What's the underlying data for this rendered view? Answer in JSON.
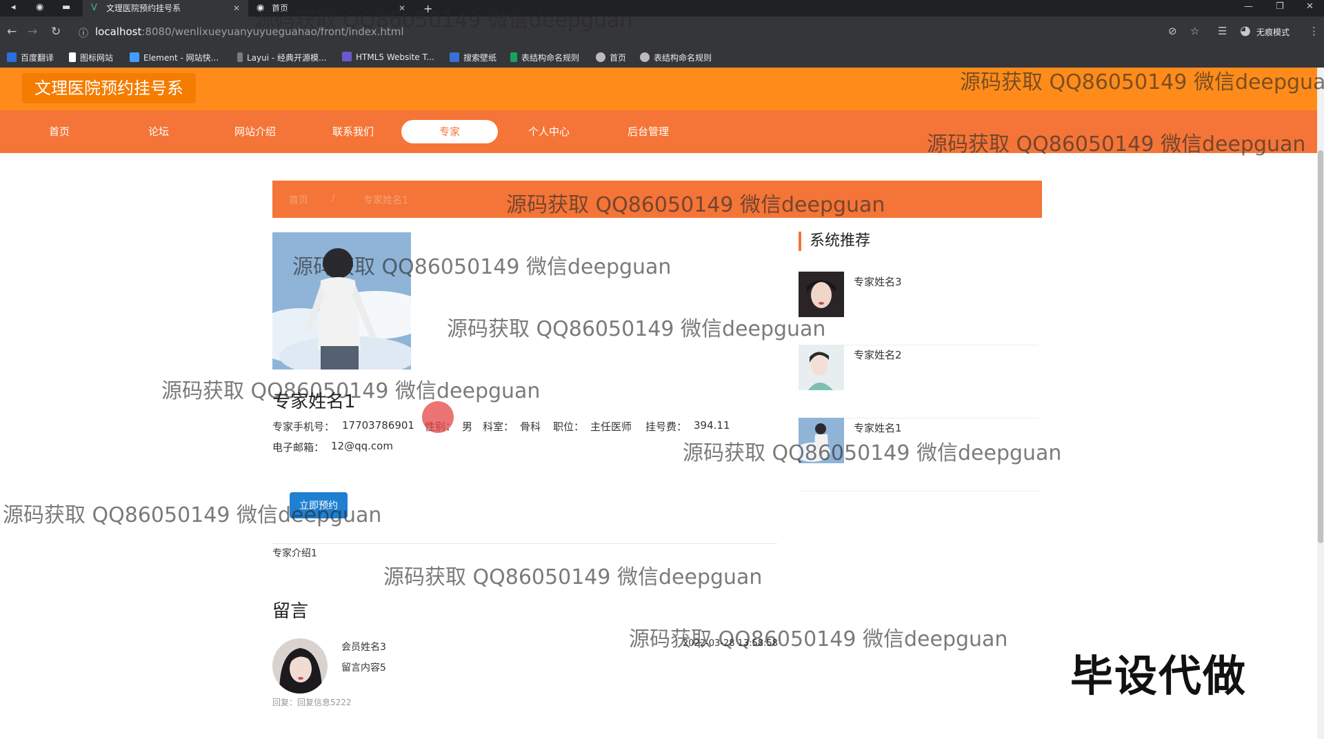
{
  "browser": {
    "tabs": [
      {
        "label": "文理医院预约挂号系",
        "active": true
      },
      {
        "label": "首页",
        "active": false
      }
    ],
    "url_host": "localhost",
    "url_path": ":8080/wenlixueyuanyuyueguahao/front/index.html",
    "incognito_label": "无痕模式",
    "bookmarks": [
      "百度翻译",
      "图标网站",
      "Element - 网站快...",
      "Layui - 经典开源模...",
      "HTML5 Website T...",
      "搜索壁纸",
      "表结构命名规则",
      "首页",
      "表结构命名规则"
    ]
  },
  "site": {
    "title": "文理医院预约挂号系",
    "nav": [
      "首页",
      "论坛",
      "网站介绍",
      "联系我们",
      "专家",
      "个人中心",
      "后台管理"
    ],
    "active_nav": "专家",
    "accent": "#f47537"
  },
  "breadcrumb": {
    "home": "首页",
    "sep": "/",
    "current": "专家姓名1"
  },
  "expert": {
    "name": "专家姓名1",
    "phone_label": "专家手机号：",
    "phone": "17703786901",
    "gender_label": "性别：",
    "gender": "男",
    "dept_label": "科室：",
    "dept": "骨科",
    "position_label": "职位：",
    "position": "主任医师",
    "fee_label": "挂号费：",
    "fee": "394.11",
    "email_label": "电子邮箱：",
    "email": "12@qq.com",
    "book_button": "立即预约",
    "intro": "专家介绍1"
  },
  "messages": {
    "title": "留言",
    "items": [
      {
        "member": "会员姓名3",
        "content": "留言内容5",
        "time": "2022-03-28 13:58:58",
        "reply_label": "回复：",
        "reply": "回复信息5222"
      }
    ]
  },
  "sidebar": {
    "title": "系统推荐",
    "items": [
      {
        "name": "专家姓名3"
      },
      {
        "name": "专家姓名2"
      },
      {
        "name": "专家姓名1"
      }
    ]
  },
  "overlay": {
    "watermark": "源码获取 QQ86050149 微信deepguan",
    "corner": "毕设代做"
  }
}
